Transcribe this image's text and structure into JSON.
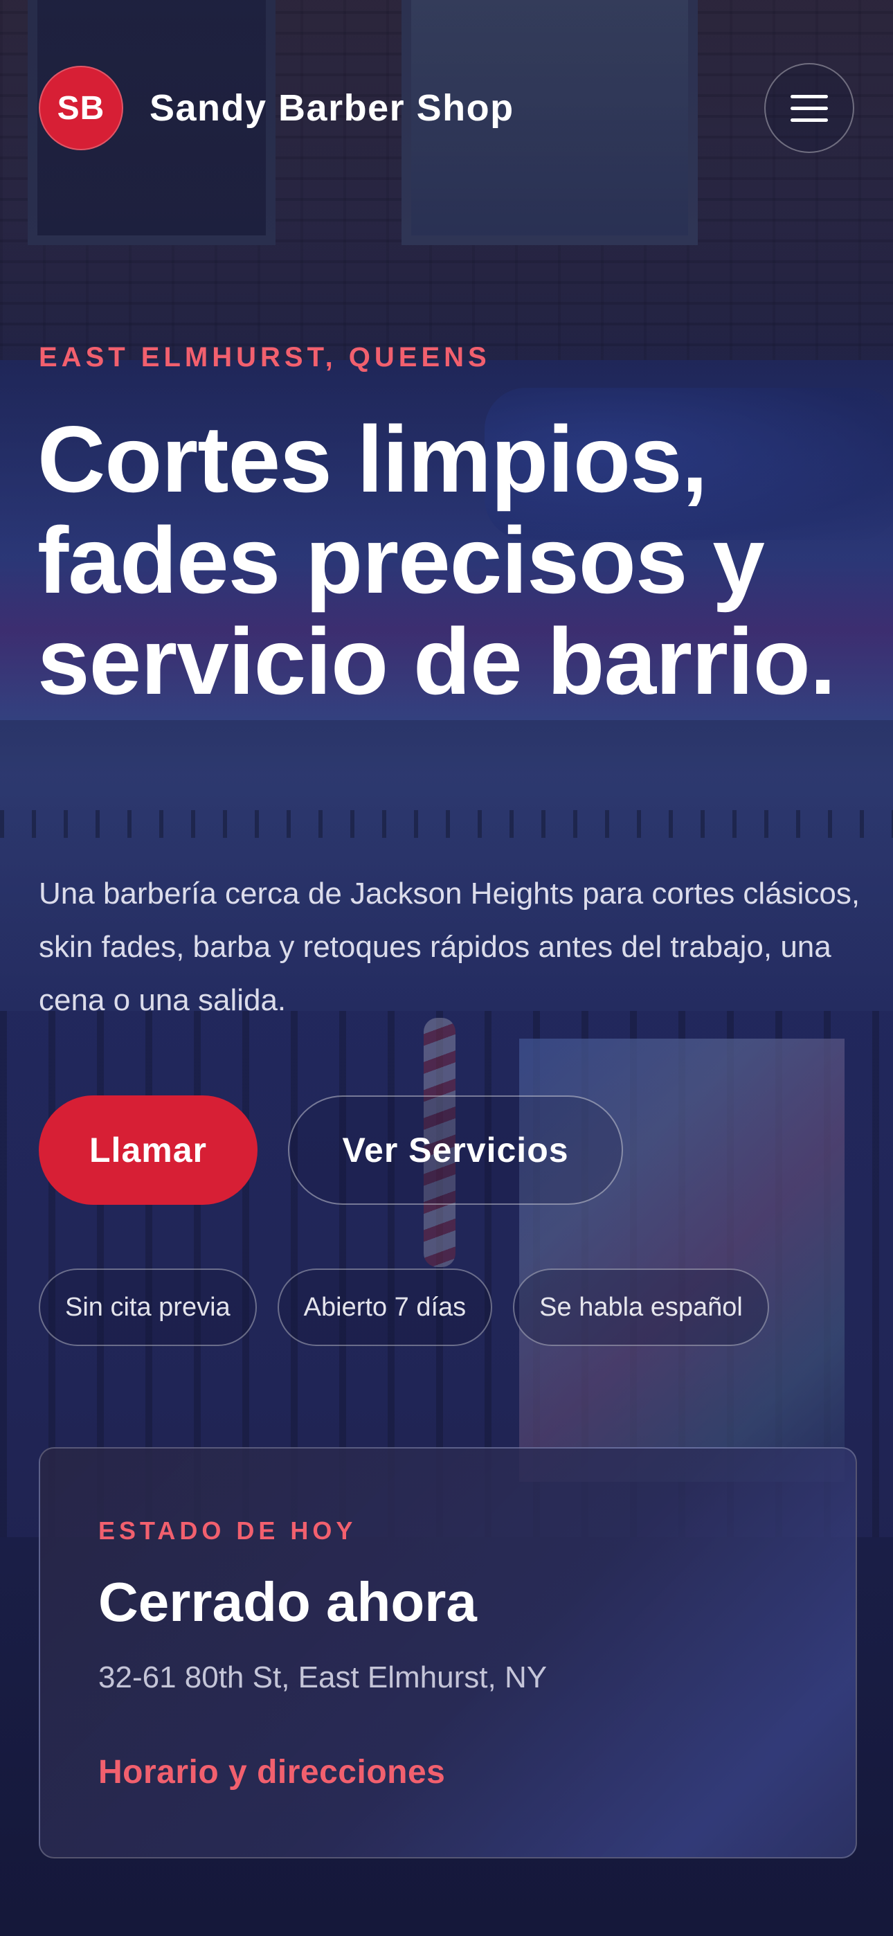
{
  "header": {
    "logo_initials": "SB",
    "brand_name": "Sandy Barber Shop",
    "menu_icon": "hamburger-menu-icon"
  },
  "hero": {
    "eyebrow": "EAST ELMHURST, QUEENS",
    "title": "Cortes limpios, fades precisos y servicio de barrio.",
    "description": "Una barbería cerca de Jackson Heights para cortes clásicos, skin fades, barba y retoques rápidos antes del trabajo, una cena o una salida.",
    "primary_cta": "Llamar",
    "secondary_cta": "Ver Servicios",
    "chips": [
      "Sin cita previa",
      "Abierto 7 días",
      "Se habla español"
    ]
  },
  "status_card": {
    "eyebrow": "ESTADO DE HOY",
    "status": "Cerrado ahora",
    "address": "32-61 80th St, East Elmhurst, NY",
    "link": "Horario y direcciones"
  },
  "colors": {
    "accent": "#d71f35",
    "accent_text": "#f2606e",
    "text": "#ffffff"
  }
}
